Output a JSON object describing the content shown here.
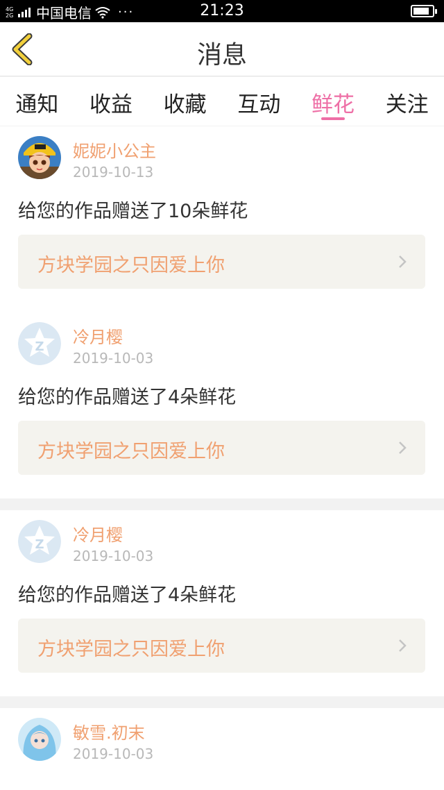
{
  "status_bar": {
    "network": "4G",
    "carrier": "中国电信",
    "time": "21:23",
    "battery_percent": 85
  },
  "nav": {
    "title": "消息"
  },
  "tabs": [
    {
      "label": "通知"
    },
    {
      "label": "收益"
    },
    {
      "label": "收藏"
    },
    {
      "label": "互动"
    },
    {
      "label": "鲜花",
      "active": true
    },
    {
      "label": "关注"
    }
  ],
  "messages": [
    {
      "username": "妮妮小公主",
      "date": "2019-10-13",
      "text": "给您的作品赠送了10朵鲜花",
      "work_title": "方块学园之只因爱上你",
      "avatar": "cartoon-avatar"
    },
    {
      "username": "冷月樱",
      "date": "2019-10-03",
      "text": "给您的作品赠送了4朵鲜花",
      "work_title": "方块学园之只因爱上你",
      "avatar": "default-avatar"
    },
    {
      "username": "冷月樱",
      "date": "2019-10-03",
      "text": "给您的作品赠送了4朵鲜花",
      "work_title": "方块学园之只因爱上你",
      "avatar": "default-avatar"
    },
    {
      "username": "敏雪.初末",
      "date": "2019-10-03",
      "text": "",
      "work_title": "",
      "avatar": "anime-avatar"
    }
  ],
  "colors": {
    "accent": "#ee6fa6",
    "name": "#f0a070",
    "back": "#f2d03c"
  }
}
